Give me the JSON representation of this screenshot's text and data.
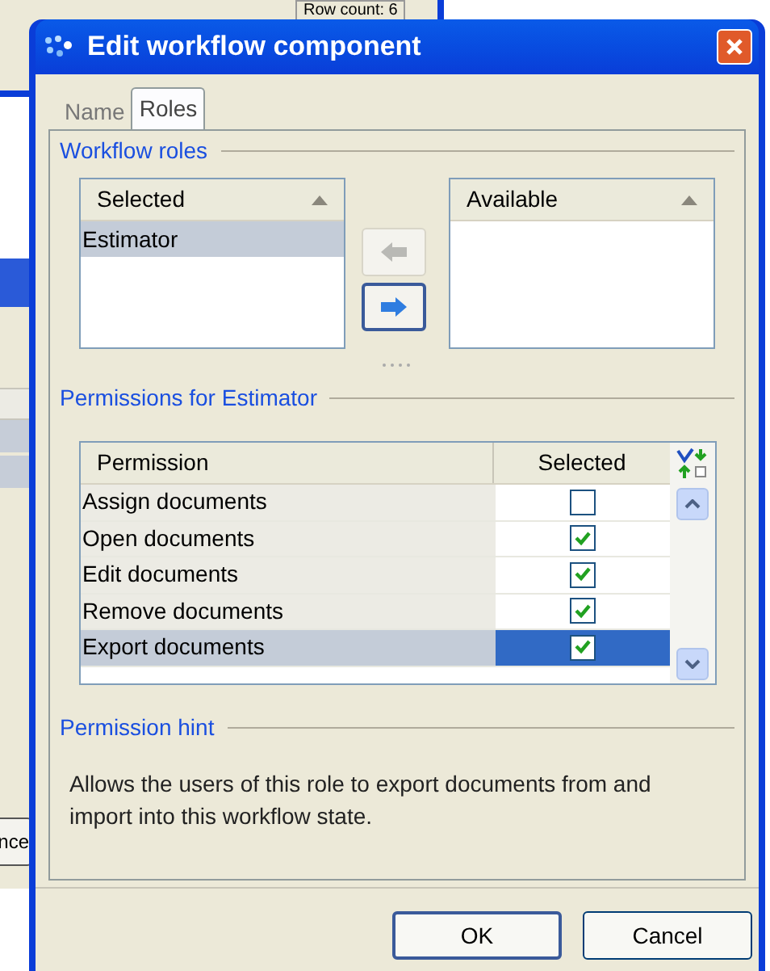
{
  "background_window": {
    "status": "Row count: 6",
    "button": "nce"
  },
  "window": {
    "title": "Edit workflow component"
  },
  "tabs": [
    {
      "label": "Name",
      "selected": false
    },
    {
      "label": "Roles",
      "selected": true
    }
  ],
  "workflow_roles": {
    "title": "Workflow roles",
    "selected_list": {
      "header": "Selected",
      "items": [
        {
          "label": "Estimator",
          "selected": true
        }
      ]
    },
    "available_list": {
      "header": "Available"
    },
    "move_left": {
      "disabled": true
    },
    "move_right": {
      "disabled": false
    }
  },
  "permissions": {
    "title": "Permissions for Estimator",
    "columns": [
      "Permission",
      "Selected"
    ],
    "rows": [
      {
        "label": "Assign documents",
        "checked": false,
        "selected": false
      },
      {
        "label": "Open documents",
        "checked": true,
        "selected": false
      },
      {
        "label": "Edit documents",
        "checked": true,
        "selected": false
      },
      {
        "label": "Remove documents",
        "checked": true,
        "selected": false
      },
      {
        "label": "Export documents",
        "checked": true,
        "selected": true
      }
    ]
  },
  "hint": {
    "title": "Permission hint",
    "text": "Allows the users of this role to export documents from and import into this workflow state."
  },
  "buttons": [
    "OK",
    "Cancel"
  ]
}
